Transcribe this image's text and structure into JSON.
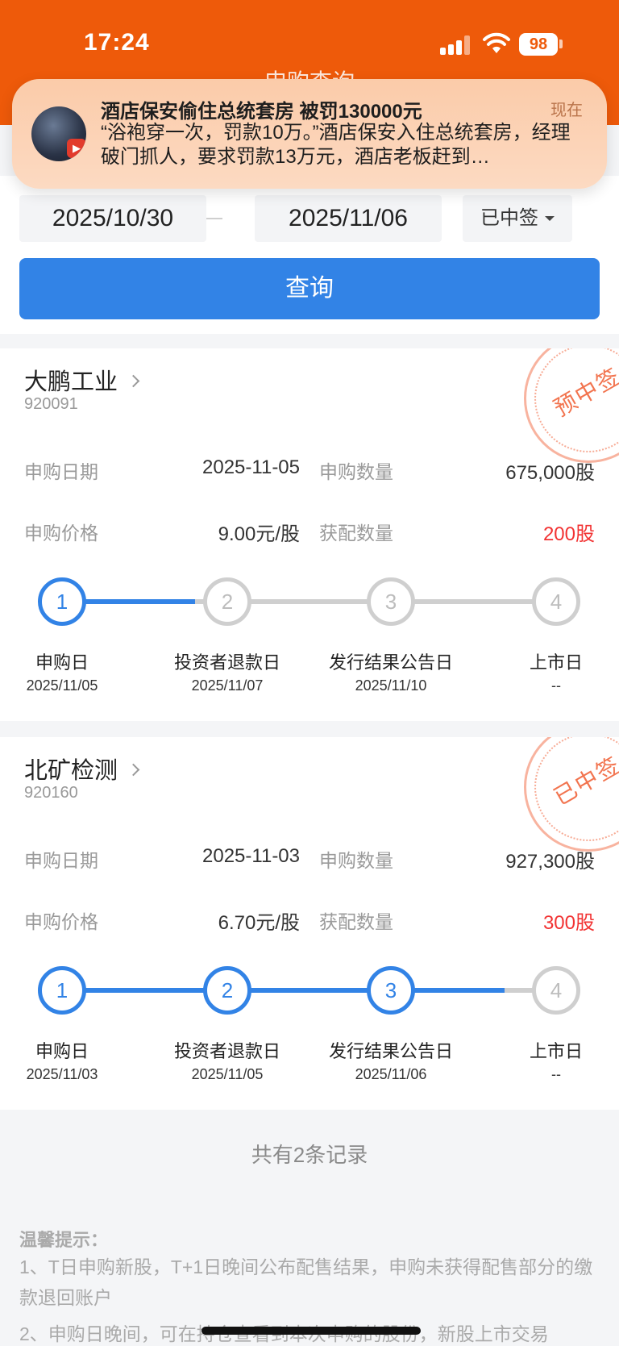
{
  "status_bar": {
    "time": "17:24",
    "battery": "98"
  },
  "nav": {
    "title": "申购查询"
  },
  "notification": {
    "title": "酒店保安偷住总统套房 被罚130000元",
    "time": "现在",
    "body": "“浴袍穿一次，罚款10万。”酒店保安入住总统套房，经理破门抓人，要求罚款13万元，酒店老板赶到…",
    "app_badge": "西瓜视频"
  },
  "filter": {
    "start_date": "2025/10/30",
    "end_date": "2025/11/06",
    "status": "已中签",
    "query_label": "查询"
  },
  "labels": {
    "subscribe_date": "申购日期",
    "subscribe_qty": "申购数量",
    "subscribe_price": "申购价格",
    "allotted_qty": "获配数量"
  },
  "records": [
    {
      "name": "大鹏工业",
      "code": "920091",
      "stamp": "预中签",
      "subscribe_date": "2025-11-05",
      "subscribe_qty": "675,000股",
      "price": "9.00元/股",
      "allotted": "200股",
      "progress_step": 1,
      "steps": [
        {
          "num": "1",
          "label": "申购日",
          "date": "2025/11/05"
        },
        {
          "num": "2",
          "label": "投资者退款日",
          "date": "2025/11/07"
        },
        {
          "num": "3",
          "label": "发行结果公告日",
          "date": "2025/11/10"
        },
        {
          "num": "4",
          "label": "上市日",
          "date": "--"
        }
      ]
    },
    {
      "name": "北矿检测",
      "code": "920160",
      "stamp": "已中签",
      "subscribe_date": "2025-11-03",
      "subscribe_qty": "927,300股",
      "price": "6.70元/股",
      "allotted": "300股",
      "progress_step": 3,
      "steps": [
        {
          "num": "1",
          "label": "申购日",
          "date": "2025/11/03"
        },
        {
          "num": "2",
          "label": "投资者退款日",
          "date": "2025/11/05"
        },
        {
          "num": "3",
          "label": "发行结果公告日",
          "date": "2025/11/06"
        },
        {
          "num": "4",
          "label": "上市日",
          "date": "--"
        }
      ]
    }
  ],
  "total": "共有2条记录",
  "tips": {
    "title": "温馨提示：",
    "items": [
      "1、T日申购新股，T+1日晚间公布配售结果，申购未获得配售部分的缴款退回账户",
      "2、申购日晚间，可在持仓查看到本次申购的股份，新股上市交易"
    ]
  },
  "colors": {
    "brand": "#ee5a0a",
    "primary": "#3283e6",
    "highlight": "#f23232",
    "stamp": "#f2744f"
  }
}
